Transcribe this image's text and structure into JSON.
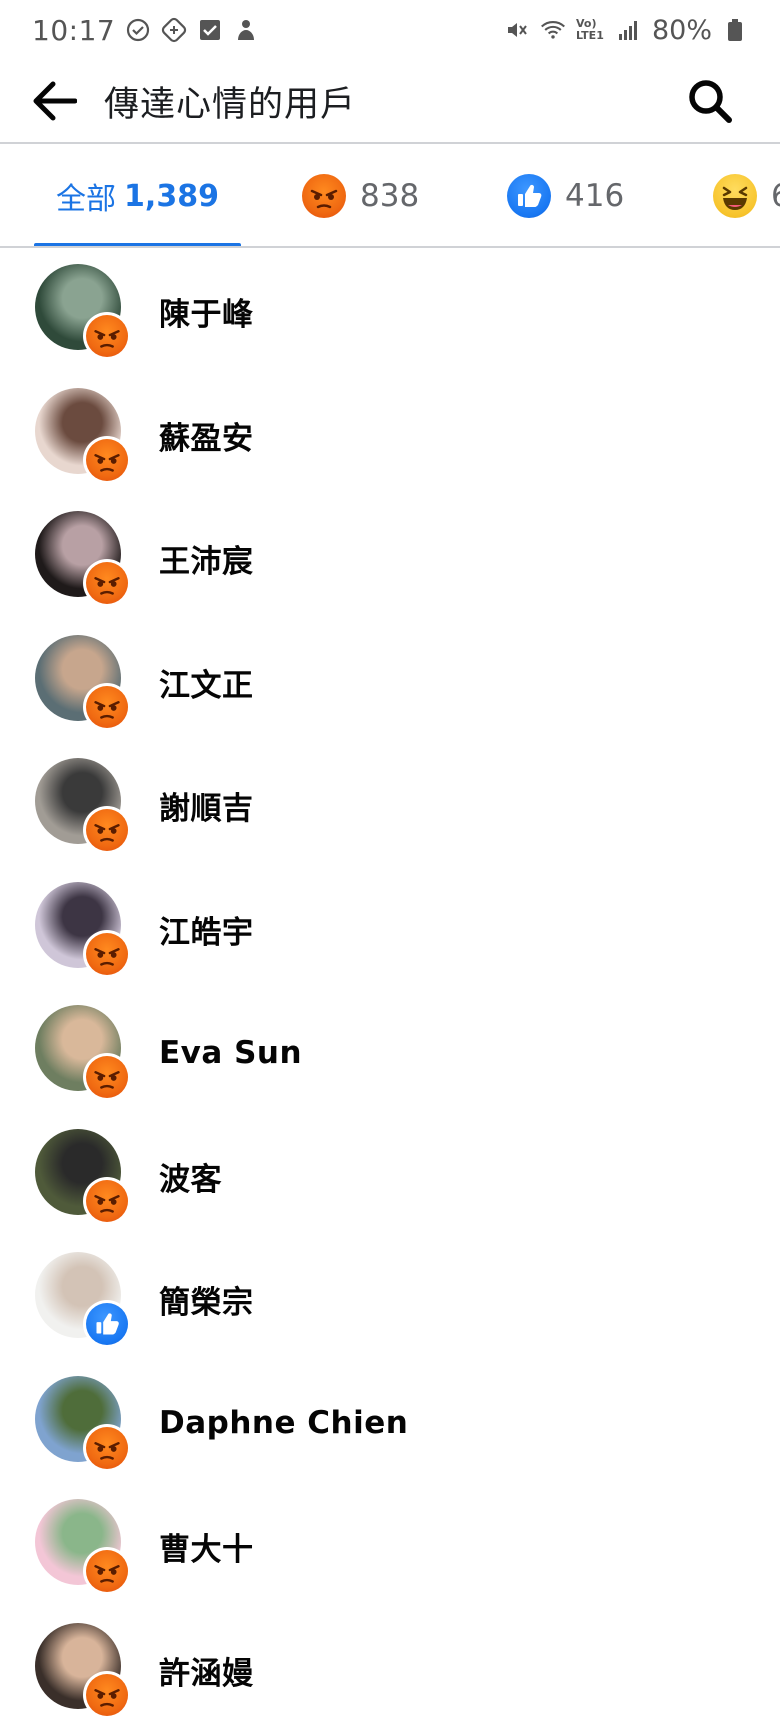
{
  "status_bar": {
    "time": "10:17",
    "battery": "80%",
    "network_label": "Vo) LTE1"
  },
  "header": {
    "title": "傳達心情的用戶"
  },
  "tabs": {
    "all_label": "全部",
    "all_count": "1,389",
    "angry_count": "838",
    "like_count": "416",
    "haha_count": "6"
  },
  "colors": {
    "accent": "#1b74e4",
    "angry": "#f06a12",
    "like": "#1877f2",
    "haha": "#f7c42d"
  },
  "users": [
    {
      "name": "陳于峰",
      "reaction": "angry"
    },
    {
      "name": "蘇盈安",
      "reaction": "angry"
    },
    {
      "name": "王沛宸",
      "reaction": "angry"
    },
    {
      "name": "江文正",
      "reaction": "angry"
    },
    {
      "name": "謝順吉",
      "reaction": "angry"
    },
    {
      "name": "江皓宇",
      "reaction": "angry"
    },
    {
      "name": "Eva Sun",
      "reaction": "angry"
    },
    {
      "name": "波客",
      "reaction": "angry"
    },
    {
      "name": "簡榮宗",
      "reaction": "like"
    },
    {
      "name": "Daphne Chien",
      "reaction": "angry"
    },
    {
      "name": "曹大十",
      "reaction": "angry"
    },
    {
      "name": "許涵嫚",
      "reaction": "angry"
    }
  ]
}
